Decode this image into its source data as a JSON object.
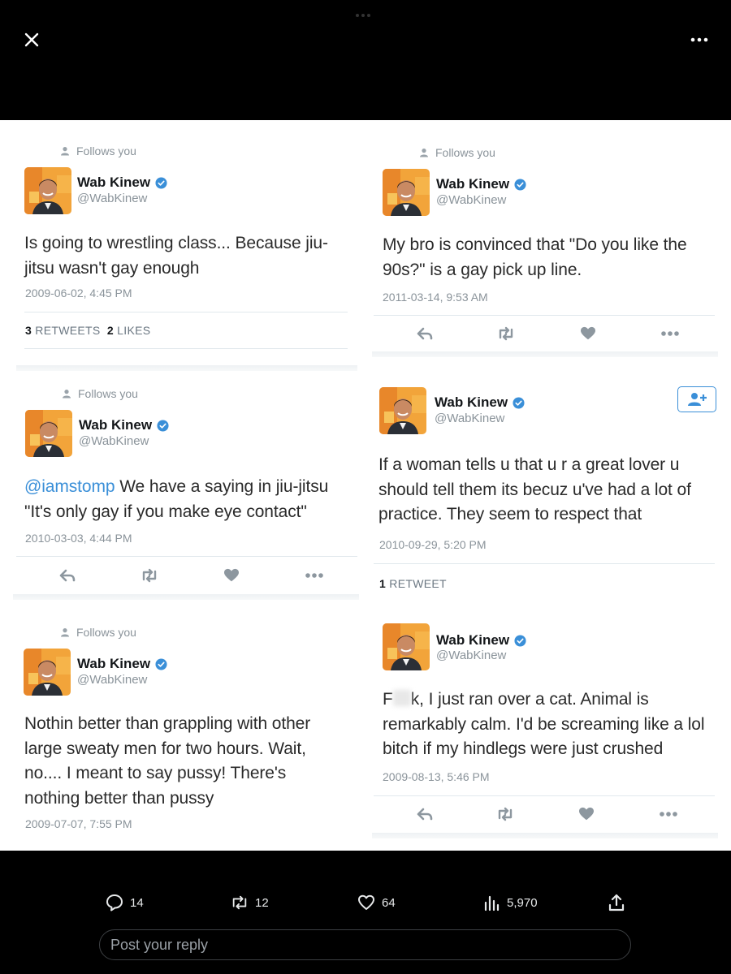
{
  "header": {
    "close_icon": "close-icon",
    "more_icon": "more-horizontal-icon"
  },
  "tweets": [
    {
      "follows_label": "Follows you",
      "name": "Wab Kinew",
      "handle": "@WabKinew",
      "text_lines": [
        "Is going to wrestling class... Because jiu-",
        "jitsu wasn't gay enough"
      ],
      "timestamp": "2009-06-02, 4:45 PM",
      "retweets_count": "3",
      "retweets_label": "RETWEETS",
      "likes_count": "2",
      "likes_label": "LIKES"
    },
    {
      "follows_label": "Follows you",
      "name": "Wab Kinew",
      "handle": "@WabKinew",
      "text_lines": [
        "My bro is convinced that \"Do you like the",
        "90s?\" is a gay pick up line."
      ],
      "timestamp": "2011-03-14, 9:53 AM"
    },
    {
      "follows_label": "Follows you",
      "name": "Wab Kinew",
      "handle": "@WabKinew",
      "mention": "@iamstomp",
      "text_line1_rest": " We have a saying in jiu-jitsu",
      "text_line2": "\"It's only gay if you make eye contact\"",
      "timestamp": "2010-03-03, 4:44 PM"
    },
    {
      "name": "Wab Kinew",
      "handle": "@WabKinew",
      "text_lines": [
        "If a woman tells u that u r a great lover u",
        "should tell them its becuz u've had a lot of",
        "practice. They seem to respect that"
      ],
      "timestamp": "2010-09-29, 5:20 PM",
      "retweets_count": "1",
      "retweets_label": "RETWEET"
    },
    {
      "follows_label": "Follows you",
      "name": "Wab Kinew",
      "handle": "@WabKinew",
      "text_lines": [
        "Nothin better than grappling with other",
        "large sweaty men for two hours. Wait,",
        "no.... I meant to say pussy! There's",
        "nothing better than pussy"
      ],
      "timestamp": "2009-07-07, 7:55 PM"
    },
    {
      "name": "Wab Kinew",
      "handle": "@WabKinew",
      "text_line1_start": "F",
      "text_line1_rest": "k, I just ran over a cat. Animal is",
      "text_lines_rest": [
        "remarkably calm. I'd be screaming like a lol",
        "bitch if my hindlegs were just crushed"
      ],
      "timestamp": "2009-08-13, 5:46 PM"
    }
  ],
  "footer": {
    "replies": "14",
    "reposts": "12",
    "likes": "64",
    "views": "5,970",
    "reply_placeholder": "Post your reply",
    "icons": [
      "comment-icon",
      "repost-icon",
      "heart-icon",
      "views-icon",
      "share-icon"
    ]
  },
  "colors": {
    "verified_blue": "#3a8fd8",
    "link_blue": "#3a8fd8",
    "muted_gray": "#8a939a",
    "dark_bg": "#000000"
  }
}
